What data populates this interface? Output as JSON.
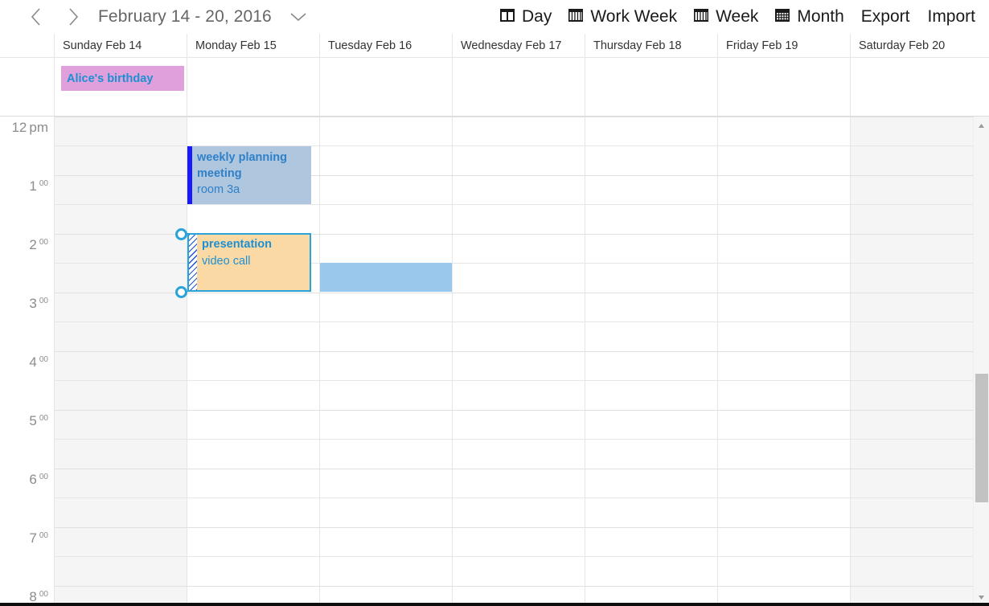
{
  "toolbar": {
    "prev_label": "‹",
    "next_label": "›",
    "date_range": "February 14 - 20, 2016",
    "caret_label": "∨",
    "views": [
      {
        "label": "Day",
        "icon": "day-view-icon"
      },
      {
        "label": "Work Week",
        "icon": "work-week-view-icon"
      },
      {
        "label": "Week",
        "icon": "week-view-icon"
      },
      {
        "label": "Month",
        "icon": "month-view-icon"
      }
    ],
    "actions": [
      {
        "label": "Export"
      },
      {
        "label": "Import"
      }
    ]
  },
  "calendar": {
    "days": [
      {
        "label": "Sunday Feb 14",
        "weekend": true
      },
      {
        "label": "Monday Feb 15",
        "weekend": false
      },
      {
        "label": "Tuesday Feb 16",
        "weekend": false
      },
      {
        "label": "Wednesday Feb 17",
        "weekend": false
      },
      {
        "label": "Thursday Feb 18",
        "weekend": false
      },
      {
        "label": "Friday Feb 19",
        "weekend": false
      },
      {
        "label": "Saturday Feb 20",
        "weekend": true
      }
    ],
    "time_labels": [
      {
        "hour": "12",
        "mins": "",
        "ampm": "pm"
      },
      {
        "hour": "1",
        "mins": "00",
        "ampm": ""
      },
      {
        "hour": "2",
        "mins": "00",
        "ampm": ""
      },
      {
        "hour": "3",
        "mins": "00",
        "ampm": ""
      },
      {
        "hour": "4",
        "mins": "00",
        "ampm": ""
      },
      {
        "hour": "5",
        "mins": "00",
        "ampm": ""
      },
      {
        "hour": "6",
        "mins": "00",
        "ampm": ""
      },
      {
        "hour": "7",
        "mins": "00",
        "ampm": ""
      },
      {
        "hour": "8",
        "mins": "00",
        "ampm": ""
      }
    ],
    "all_day_events": [
      {
        "title": "Alice's birthday",
        "day_index": 0,
        "background": "#e0a0dc",
        "text_color": "#1e90d2"
      }
    ],
    "events": [
      {
        "title": "weekly planning meeting",
        "subtitle": "room 3a",
        "day_index": 1,
        "background": "#afc7de",
        "bar_color": "#1a1aff",
        "text_color": "#2f80c8"
      }
    ],
    "selected_event": {
      "title": "presentation",
      "subtitle": "video call",
      "day_index": 1,
      "border_color": "#29a3d8",
      "background": "#fad9a5",
      "text_color": "#1e90d2"
    },
    "selection_block": {
      "day_index": 2,
      "background": "#9ac8ec"
    }
  },
  "scrollbar": {
    "up_arrow": "▲",
    "down_arrow": "▼",
    "thumb_color": "#c2c2c2"
  }
}
